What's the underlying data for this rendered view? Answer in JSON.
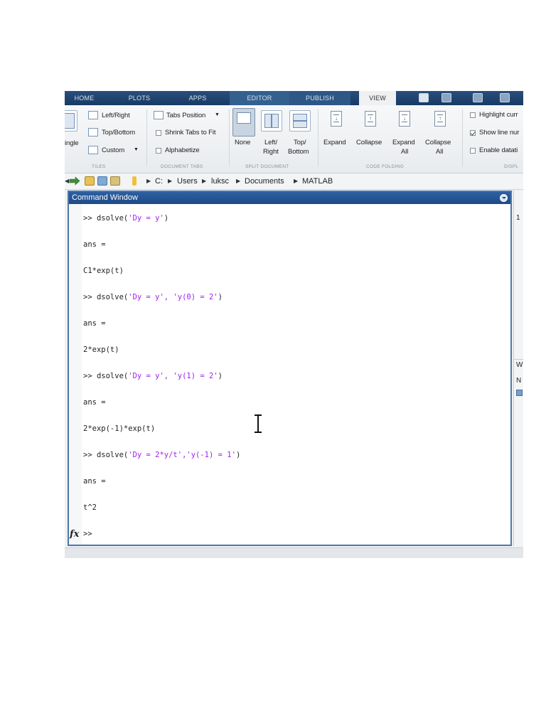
{
  "tabs": [
    "HOME",
    "PLOTS",
    "APPS",
    "EDITOR",
    "PUBLISH",
    "VIEW"
  ],
  "ribbon": {
    "tiles": {
      "single_label": "ingle",
      "left_right": "Left/Right",
      "top_bottom": "Top/Bottom",
      "custom": "Custom",
      "section": "TILES"
    },
    "document_tabs": {
      "tabs_position": "Tabs Position",
      "shrink": "Shrink Tabs to Fit",
      "alphabetize": "Alphabetize",
      "section": "DOCUMENT TABS"
    },
    "split_document": {
      "none": "None",
      "left": "Left/",
      "right": "Right",
      "top": "Top/",
      "bottom": "Bottom",
      "section": "SPLIT DOCUMENT"
    },
    "code_folding": {
      "expand": "Expand",
      "collapse": "Collapse",
      "expand_all_1": "Expand",
      "expand_all_2": "All",
      "collapse_all_1": "Collapse",
      "collapse_all_2": "All",
      "section": "CODE FOLDING"
    },
    "display": {
      "highlight": "Highlight curr",
      "show_line": "Show line nur",
      "enable_datatips": "Enable datati",
      "section": "DISPL"
    }
  },
  "path": [
    "C:",
    "Users",
    "luksc",
    "Documents",
    "MATLAB"
  ],
  "command_window": {
    "title": "Command Window",
    "lines": [
      {
        "prompt": ">> dsolve(",
        "str": "'Dy = y'",
        "tail": ")"
      },
      {
        "text": "ans ="
      },
      {
        "text": "C1*exp(t)"
      },
      {
        "prompt": ">> dsolve(",
        "str": "'Dy = y', 'y(0) = 2'",
        "tail": ")"
      },
      {
        "text": "ans ="
      },
      {
        "text": "2*exp(t)"
      },
      {
        "prompt": ">> dsolve(",
        "str": "'Dy = y', 'y(1) = 2'",
        "tail": ")"
      },
      {
        "text": "ans ="
      },
      {
        "text": "2*exp(-1)*exp(t)"
      },
      {
        "prompt": ">> dsolve(",
        "str": "'Dy = 2*y/t','y(-1) = 1'",
        "tail": ")"
      },
      {
        "text": "ans ="
      },
      {
        "text": "t^2"
      },
      {
        "text": ">>"
      }
    ],
    "fx": "fx"
  },
  "right_panel": {
    "top_digit": "1",
    "w": "W",
    "n": "N"
  },
  "colors": {
    "string": "#a020f0",
    "title_bar": "#1e4b88",
    "tab_strip": "#173a64"
  },
  "icons": [
    "back-arrow-icon",
    "forward-arrow-icon",
    "folder-icon",
    "command-window-menu-icon",
    "fx-icon",
    "text-cursor-icon"
  ]
}
